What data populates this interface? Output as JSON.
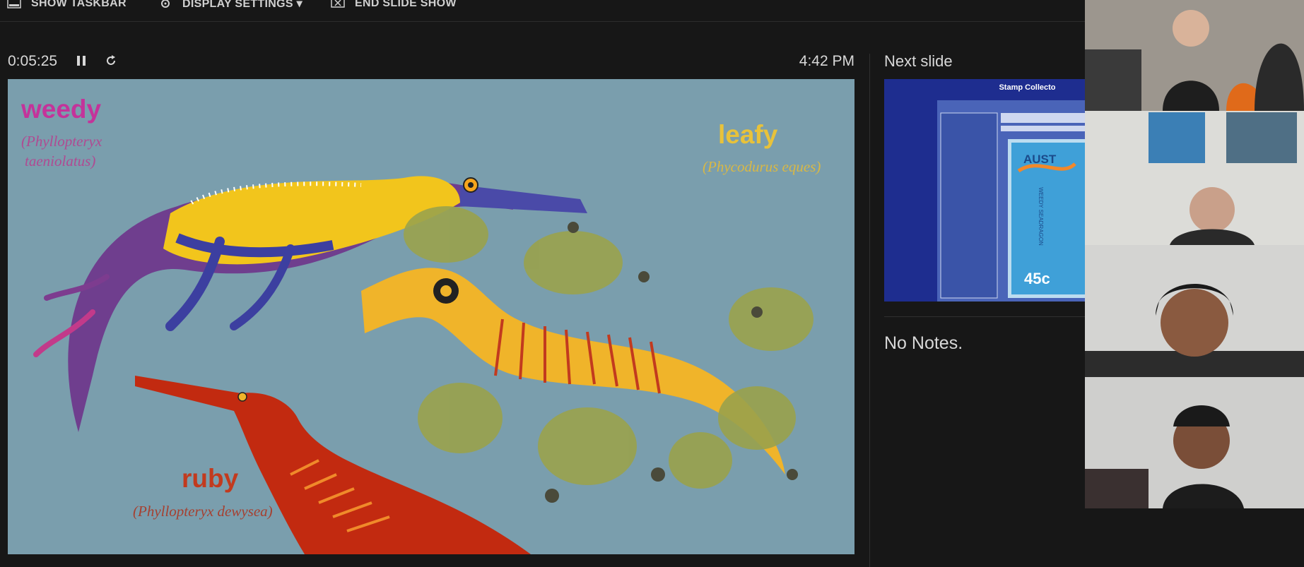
{
  "toolbar": {
    "show_taskbar": "SHOW TASKBAR",
    "display_settings": "DISPLAY SETTINGS ▾",
    "end_slide_show": "END SLIDE SHOW"
  },
  "presenter": {
    "elapsed": "0:05:25",
    "clock": "4:42 PM",
    "next_slide_label": "Next slide",
    "notes_text": "No Notes."
  },
  "slide": {
    "weedy": {
      "name": "weedy",
      "sci1": "(Phyllopteryx",
      "sci2": "taeniolatus)"
    },
    "leafy": {
      "name": "leafy",
      "sci": "(Phycodurus eques)"
    },
    "ruby": {
      "name": "ruby",
      "sci": "(Phyllopteryx dewysea)"
    }
  },
  "next_slide": {
    "header": "Stamp Collecto",
    "stamp_value": "45c",
    "stamp_country": "AUST",
    "stamp_caption": "WEEDY SEADRAGON"
  },
  "colors": {
    "background": "#171717",
    "slide_bg": "#7a9ead",
    "weedy_label": "#c4339a",
    "leafy_label": "#e8c23a",
    "ruby_label": "#c23a1e",
    "thumb_bg": "#1e2d8f"
  }
}
